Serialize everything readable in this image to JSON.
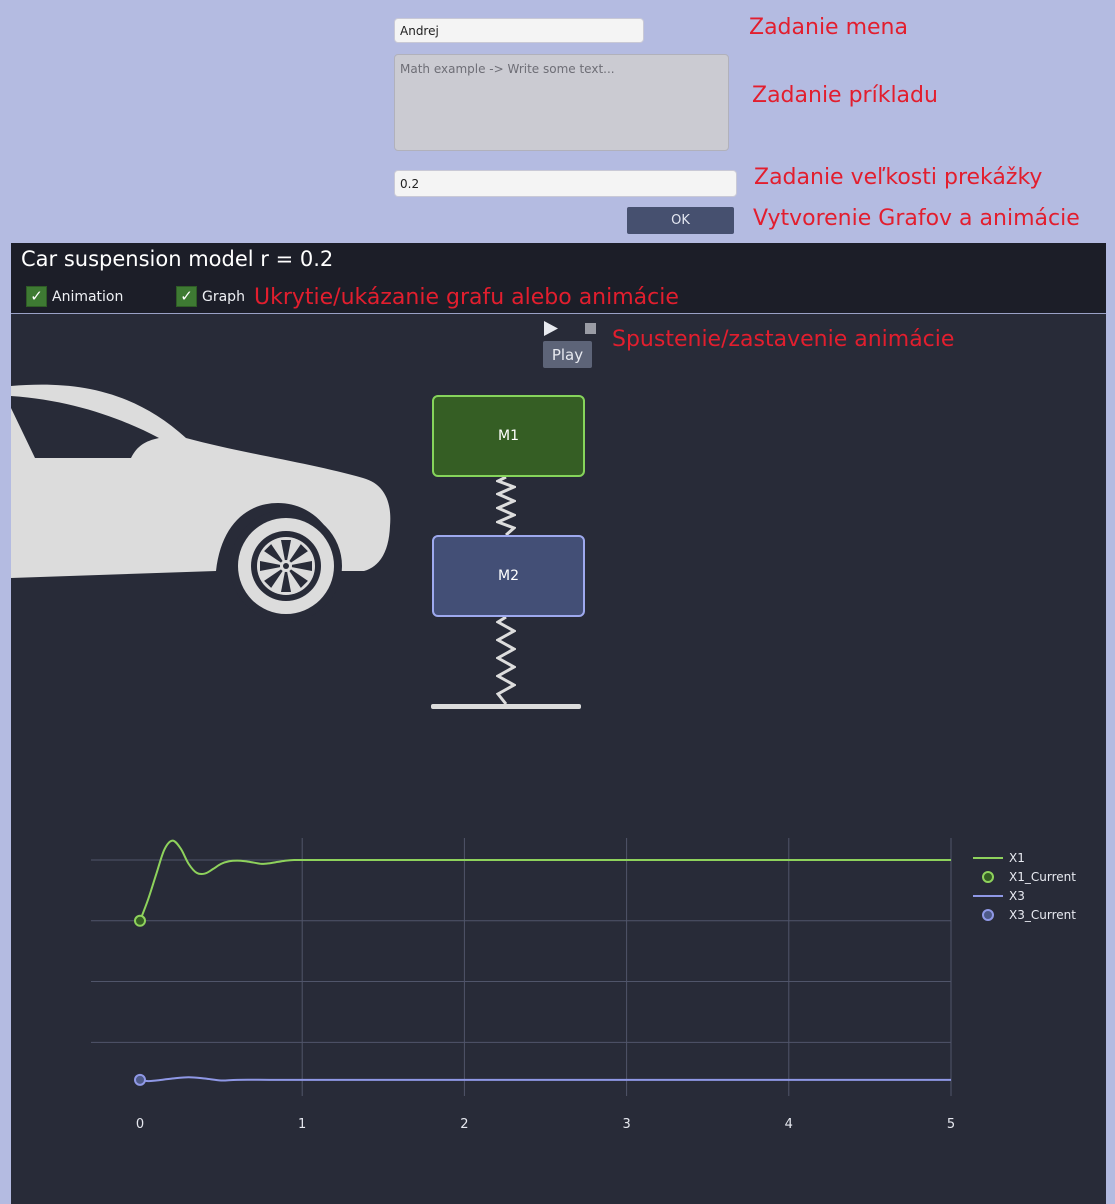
{
  "form": {
    "name_value": "Andrej",
    "example_placeholder": "Math example -> Write some text...",
    "obstacle_value": "0.2",
    "ok_label": "OK"
  },
  "annotations": {
    "name": "Zadanie mena",
    "example": "Zadanie príkladu",
    "obstacle": "Zadanie veľkosti prekážky",
    "create": "Vytvorenie Grafov a animácie",
    "toggle": "Ukrytie/ukázanie grafu alebo animácie",
    "play": "Spustenie/zastavenie animácie"
  },
  "panel": {
    "title": "Car suspension model r = 0.2",
    "checkboxes": [
      {
        "label": "Animation",
        "checked": true
      },
      {
        "label": "Graph",
        "checked": true
      }
    ],
    "play_label": "Play",
    "masses": {
      "m1": "M1",
      "m2": "M2"
    }
  },
  "colors": {
    "x1": "#8ed25c",
    "x3": "#8f98e6",
    "m1_fill": "#355e24",
    "m2_fill": "#434f76"
  },
  "icons": [
    "play-icon",
    "stop-icon",
    "checkmark-icon",
    "car-icon"
  ],
  "chart_data": {
    "type": "line",
    "xlim": [
      0,
      5
    ],
    "x_ticks": [
      "0",
      "1",
      "2",
      "3",
      "4",
      "5"
    ],
    "grid": true,
    "legend_position": "top-right",
    "series": [
      {
        "name": "X1",
        "x": [
          0,
          0.05,
          0.1,
          0.15,
          0.2,
          0.25,
          0.3,
          0.35,
          0.4,
          0.45,
          0.5,
          0.55,
          0.6,
          0.65,
          0.7,
          0.75,
          0.8,
          0.85,
          0.9,
          0.95,
          1.0,
          1.1,
          1.2,
          1.3,
          1.5,
          1.8,
          2.0,
          3.0,
          4.0,
          5.0
        ],
        "y": [
          0,
          0.33,
          0.72,
          1.1,
          1.24,
          1.12,
          0.88,
          0.74,
          0.73,
          0.8,
          0.88,
          0.92,
          0.93,
          0.92,
          0.9,
          0.88,
          0.89,
          0.91,
          0.93,
          0.94,
          0.94,
          0.94,
          0.94,
          0.94,
          0.94,
          0.94,
          0.94,
          0.94,
          0.94,
          0.94
        ]
      },
      {
        "name": "X1_Current",
        "marker": true,
        "x": [
          0
        ],
        "y": [
          0
        ]
      },
      {
        "name": "X3",
        "x": [
          0,
          0.05,
          0.1,
          0.2,
          0.3,
          0.4,
          0.5,
          0.6,
          0.8,
          1.0,
          2.0,
          3.0,
          4.0,
          5.0
        ],
        "y": [
          -2.46,
          -2.48,
          -2.47,
          -2.44,
          -2.42,
          -2.44,
          -2.47,
          -2.46,
          -2.46,
          -2.46,
          -2.46,
          -2.46,
          -2.46,
          -2.46
        ]
      },
      {
        "name": "X3_Current",
        "marker": true,
        "x": [
          0
        ],
        "y": [
          -2.46
        ]
      }
    ]
  }
}
